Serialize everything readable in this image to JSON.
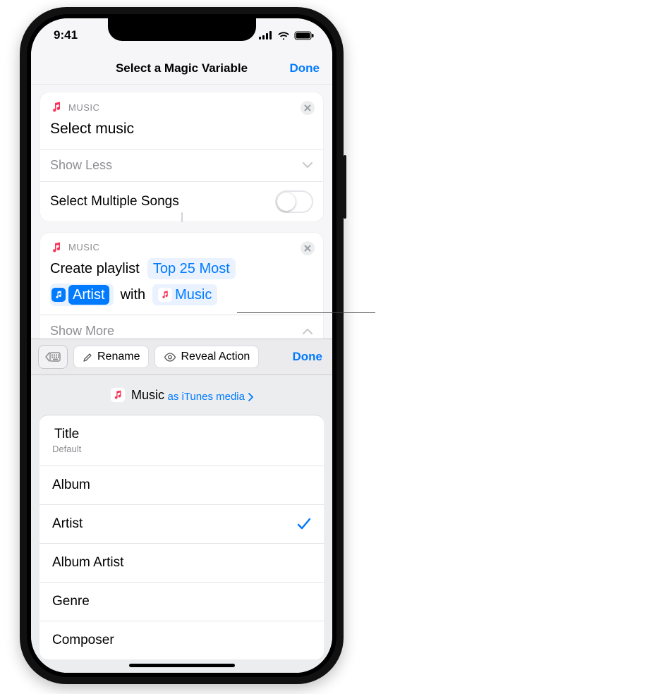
{
  "statusbar": {
    "time": "9:41"
  },
  "navbar": {
    "title": "Select a Magic Variable",
    "done": "Done"
  },
  "card1": {
    "category": "MUSIC",
    "title": "Select music",
    "show_less": "Show Less",
    "row_label": "Select Multiple Songs"
  },
  "card2": {
    "category": "MUSIC",
    "line_prefix": "Create playlist",
    "token1": "Top 25 Most",
    "token_artist": "Artist",
    "mid_word": "with",
    "token_music": "Music",
    "show_more": "Show More"
  },
  "accessory": {
    "rename": "Rename",
    "reveal": "Reveal Action",
    "done": "Done"
  },
  "var_header": {
    "name": "Music",
    "as_line": "as iTunes media"
  },
  "properties": [
    {
      "label": "Title",
      "sub": "Default",
      "checked": false
    },
    {
      "label": "Album",
      "sub": "",
      "checked": false
    },
    {
      "label": "Artist",
      "sub": "",
      "checked": true
    },
    {
      "label": "Album Artist",
      "sub": "",
      "checked": false
    },
    {
      "label": "Genre",
      "sub": "",
      "checked": false
    },
    {
      "label": "Composer",
      "sub": "",
      "checked": false
    }
  ]
}
